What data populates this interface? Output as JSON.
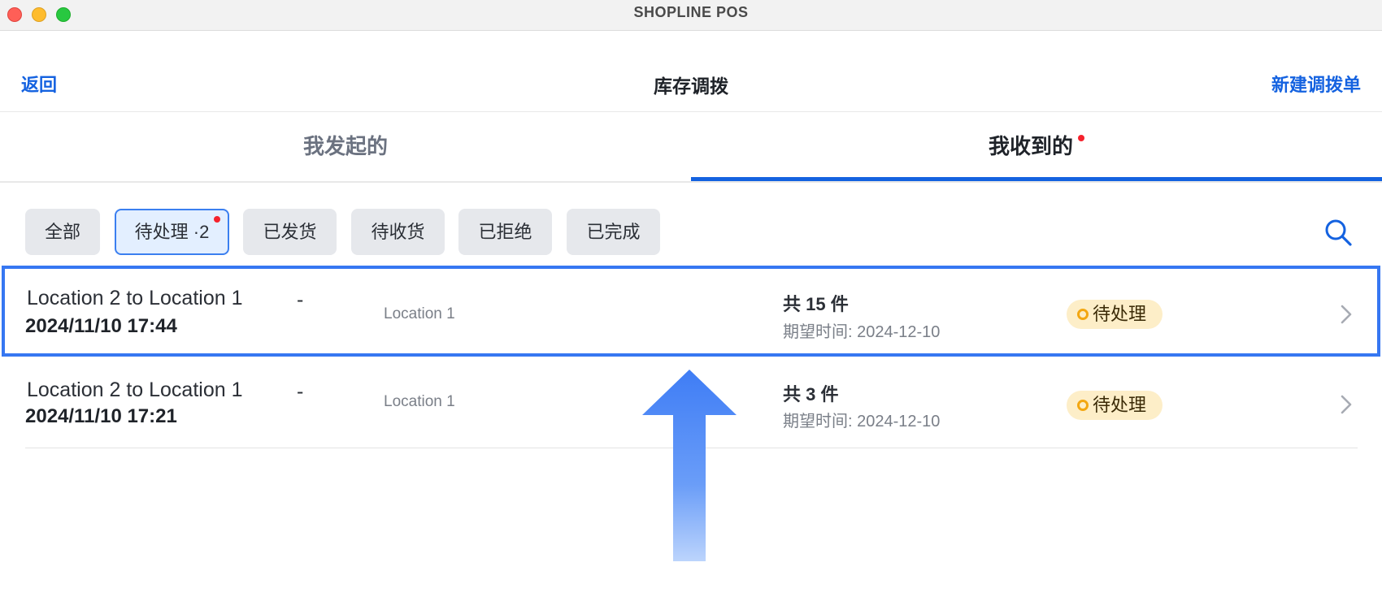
{
  "window": {
    "title": "SHOPLINE POS"
  },
  "header": {
    "back_label": "返回",
    "title": "库存调拨",
    "new_label": "新建调拨单"
  },
  "tabs": [
    {
      "label": "我发起的",
      "active": false
    },
    {
      "label": "我收到的",
      "active": true,
      "has_dot": true
    }
  ],
  "filters": [
    {
      "label": "全部",
      "active": false
    },
    {
      "label": "待处理 ·2",
      "active": true,
      "has_dot": true
    },
    {
      "label": "已发货",
      "active": false
    },
    {
      "label": "待收货",
      "active": false
    },
    {
      "label": "已拒绝",
      "active": false
    },
    {
      "label": "已完成",
      "active": false
    }
  ],
  "search": {
    "icon": "search-icon"
  },
  "transfers": [
    {
      "title": "Location 2 to Location 1",
      "dash": "-",
      "date": "2024/11/10 17:44",
      "location": "Location 1",
      "count": "共 15 件",
      "expected": "期望时间: 2024-12-10",
      "status": "待处理",
      "highlighted": true
    },
    {
      "title": "Location 2 to Location 1",
      "dash": "-",
      "date": "2024/11/10 17:21",
      "location": "Location 1",
      "count": "共 3 件",
      "expected": "期望时间: 2024-12-10",
      "status": "待处理",
      "highlighted": false
    }
  ],
  "colors": {
    "accent": "#1462e0",
    "highlight_border": "#3677f2",
    "status_bg": "#fdeec8",
    "status_ring": "#f3a712",
    "dot_red": "#f5222d"
  }
}
